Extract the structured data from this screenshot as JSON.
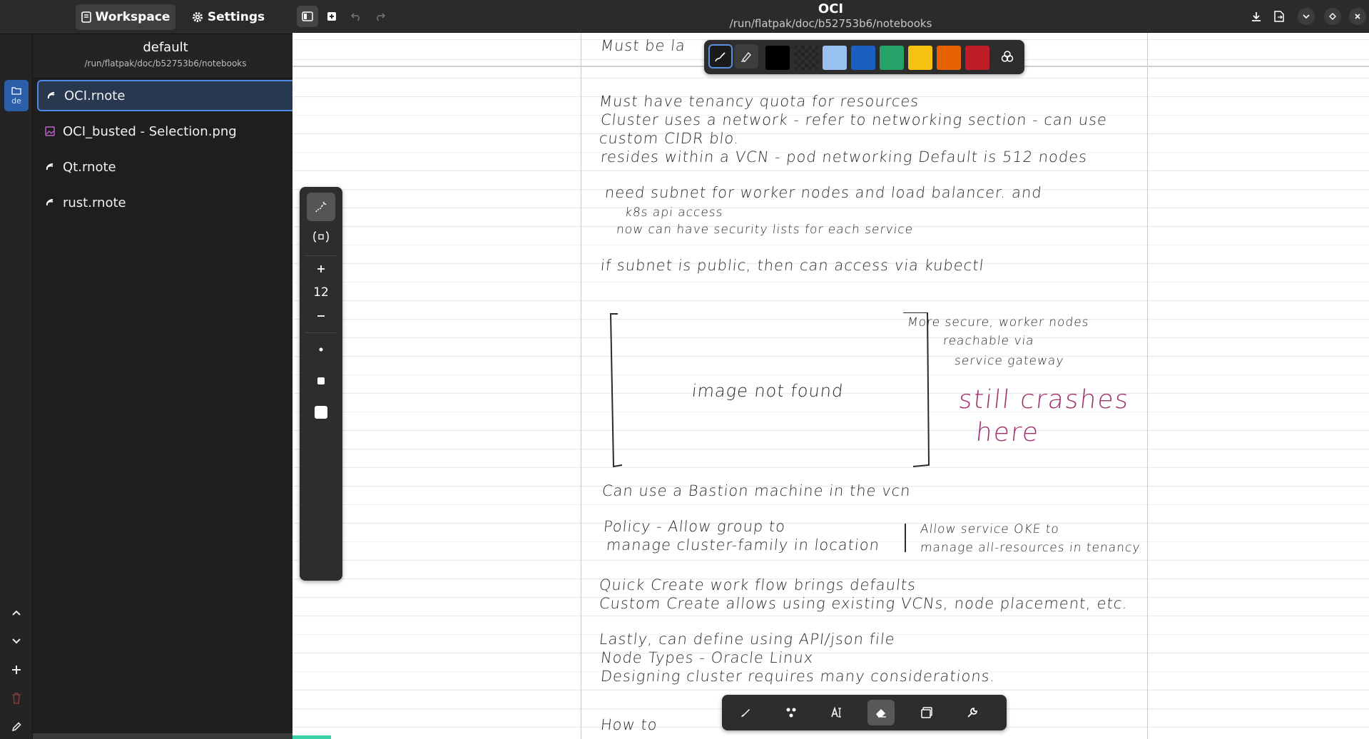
{
  "sidebar": {
    "tabs": [
      {
        "label": "Workspace",
        "icon": "notebook-icon",
        "active": true
      },
      {
        "label": "Settings",
        "icon": "gear-icon",
        "active": false
      }
    ],
    "workspace": {
      "name": "default",
      "path": "/run/flatpak/doc/b52753b6/notebooks",
      "short_label": "de"
    },
    "files": [
      {
        "name": "OCI.rnote",
        "type": "rnote",
        "selected": true
      },
      {
        "name": "OCI_busted - Selection.png",
        "type": "image",
        "selected": false
      },
      {
        "name": "Qt.rnote",
        "type": "rnote",
        "selected": false
      },
      {
        "name": "rust.rnote",
        "type": "rnote",
        "selected": false
      }
    ]
  },
  "header": {
    "title": "OCI",
    "subtitle": "/run/flatpak/doc/b52753b6/notebooks"
  },
  "pen_colors": {
    "colors": [
      "#000000",
      "#2a2a2a",
      "#99c1f1",
      "#1c5fc2",
      "#26a269",
      "#f5c211",
      "#e66100",
      "#c01c28"
    ]
  },
  "side_tools": {
    "pen_size": "12"
  },
  "notes": {
    "line_01": "Must be la",
    "line_02": "Must have tenancy quota for resources",
    "line_03": "Cluster uses a network - refer to networking section - can use",
    "line_04": "custom CIDR blo.",
    "line_05": "resides within a VCN - pod networking  Default is 512 nodes",
    "line_06": "need subnet for worker nodes and load balancer. and",
    "line_07": "k8s api access",
    "line_08": "now can have security lists for each service",
    "line_09": "if subnet is public, then can access via kubectl",
    "image_placeholder": "image not found",
    "side_1": "More secure, worker nodes",
    "side_2": "reachable via",
    "side_3": "service gateway",
    "purple_1": "still crashes",
    "purple_2": "here",
    "line_10": "Can use a Bastion machine in the vcn",
    "line_11": "Policy - Allow group to",
    "line_12": "manage cluster-family in location",
    "line_13": "Allow service OKE to",
    "line_14": "manage all-resources in tenancy",
    "line_15": "Quick Create work flow brings defaults",
    "line_16": "Custom Create  allows using existing VCNs, node placement, etc.",
    "line_17": "Lastly, can define using API/json file",
    "line_18": "Node Types - Oracle Linux",
    "line_19": "Designing cluster requires many considerations.",
    "line_20": "How to"
  }
}
